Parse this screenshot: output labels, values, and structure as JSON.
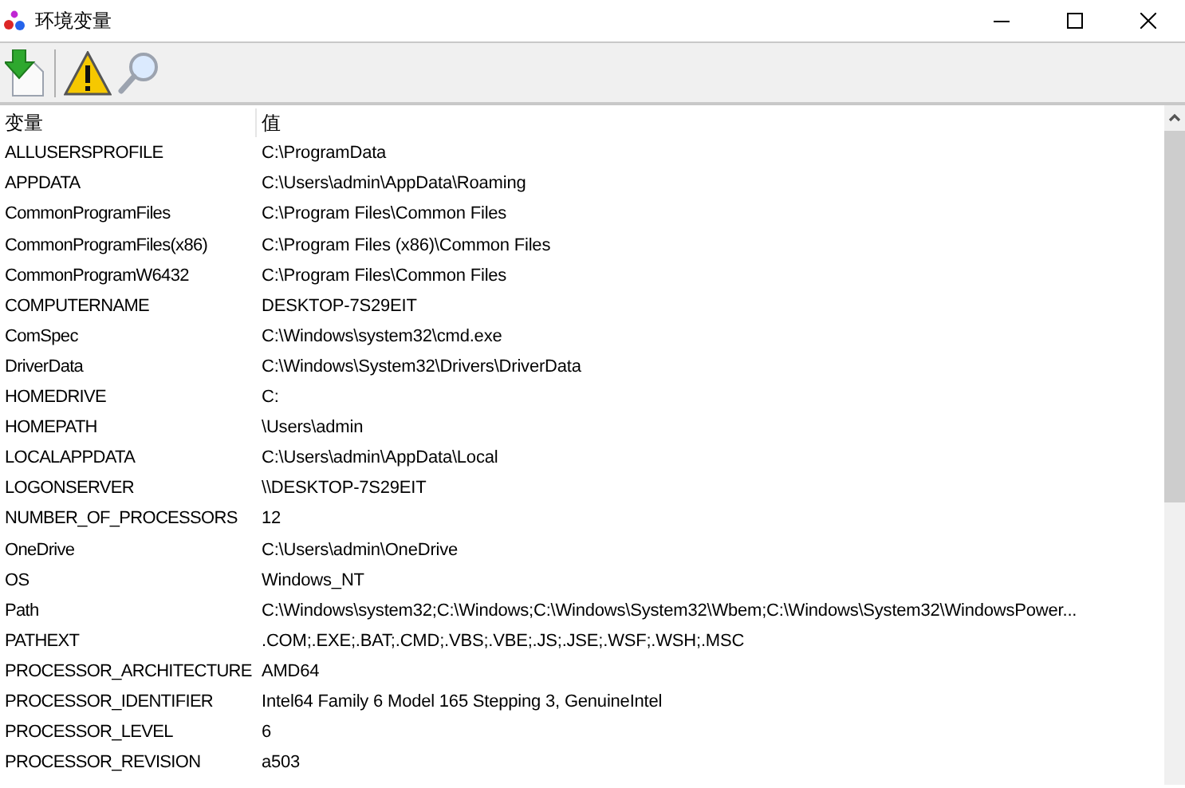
{
  "window": {
    "title": "环境变量"
  },
  "table": {
    "columns": [
      "变量",
      "值"
    ],
    "rows": [
      [
        "ALLUSERSPROFILE",
        "C:\\ProgramData"
      ],
      [
        "APPDATA",
        "C:\\Users\\admin\\AppData\\Roaming"
      ],
      [
        "CommonProgramFiles",
        "C:\\Program Files\\Common Files"
      ],
      [
        "CommonProgramFiles(x86)",
        "C:\\Program Files (x86)\\Common Files"
      ],
      [
        "CommonProgramW6432",
        "C:\\Program Files\\Common Files"
      ],
      [
        "COMPUTERNAME",
        "DESKTOP-7S29EIT"
      ],
      [
        "ComSpec",
        "C:\\Windows\\system32\\cmd.exe"
      ],
      [
        "DriverData",
        "C:\\Windows\\System32\\Drivers\\DriverData"
      ],
      [
        "HOMEDRIVE",
        "C:"
      ],
      [
        "HOMEPATH",
        "\\Users\\admin"
      ],
      [
        "LOCALAPPDATA",
        "C:\\Users\\admin\\AppData\\Local"
      ],
      [
        "LOGONSERVER",
        "\\\\DESKTOP-7S29EIT"
      ],
      [
        "NUMBER_OF_PROCESSORS",
        "12"
      ],
      [
        "OneDrive",
        "C:\\Users\\admin\\OneDrive"
      ],
      [
        "OS",
        "Windows_NT"
      ],
      [
        "Path",
        "C:\\Windows\\system32;C:\\Windows;C:\\Windows\\System32\\Wbem;C:\\Windows\\System32\\WindowsPower..."
      ],
      [
        "PATHEXT",
        ".COM;.EXE;.BAT;.CMD;.VBS;.VBE;.JS;.JSE;.WSF;.WSH;.MSC"
      ],
      [
        "PROCESSOR_ARCHITECTURE",
        "AMD64"
      ],
      [
        "PROCESSOR_IDENTIFIER",
        "Intel64 Family 6 Model 165 Stepping 3, GenuineIntel"
      ],
      [
        "PROCESSOR_LEVEL",
        "6"
      ],
      [
        "PROCESSOR_REVISION",
        "a503"
      ]
    ]
  }
}
